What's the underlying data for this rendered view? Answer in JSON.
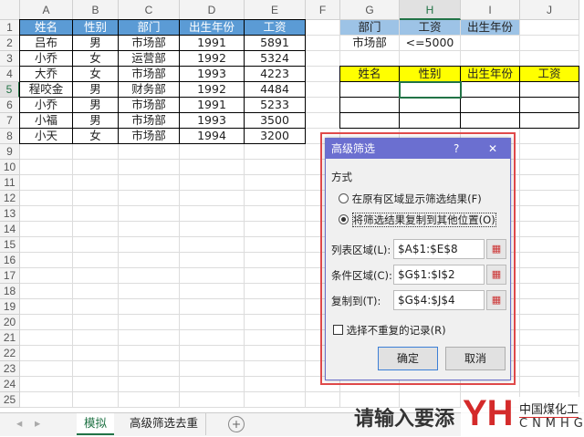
{
  "columns": [
    "A",
    "B",
    "C",
    "D",
    "E",
    "F",
    "G",
    "H",
    "I",
    "J"
  ],
  "rows": 25,
  "table": {
    "headers": [
      "姓名",
      "性别",
      "部门",
      "出生年份",
      "工资"
    ],
    "data": [
      [
        "吕布",
        "男",
        "市场部",
        "1991",
        "5891"
      ],
      [
        "小乔",
        "女",
        "运营部",
        "1992",
        "5324"
      ],
      [
        "大乔",
        "女",
        "市场部",
        "1993",
        "4223"
      ],
      [
        "程咬金",
        "男",
        "财务部",
        "1992",
        "4484"
      ],
      [
        "小乔",
        "男",
        "市场部",
        "1991",
        "5233"
      ],
      [
        "小福",
        "男",
        "市场部",
        "1993",
        "3500"
      ],
      [
        "小天",
        "女",
        "市场部",
        "1994",
        "3200"
      ]
    ]
  },
  "criteria": {
    "headers": [
      "部门",
      "工资",
      "出生年份"
    ],
    "values": [
      "市场部",
      "<=5000",
      ""
    ]
  },
  "output": {
    "headers": [
      "姓名",
      "性别",
      "出生年份",
      "工资"
    ]
  },
  "dialog": {
    "title": "高级筛选",
    "help": "?",
    "close": "✕",
    "group_label": "方式",
    "option1": "在原有区域显示筛选结果(F)",
    "option2": "将筛选结果复制到其他位置(O)",
    "list_label": "列表区域(L):",
    "list_value": "$A$1:$E$8",
    "criteria_label": "条件区域(C):",
    "criteria_value": "$G$1:$I$2",
    "copy_label": "复制到(T):",
    "copy_value": "$G$4:$J$4",
    "unique_label": "选择不重复的记录(R)",
    "ok": "确定",
    "cancel": "取消"
  },
  "tabs": {
    "items": [
      "模拟",
      "高级筛选去重"
    ],
    "active": 0,
    "add": "+"
  },
  "overlay": {
    "text": "请输入要添",
    "logo_mark": "YH",
    "logo_cn": "中国煤化工",
    "logo_en": "CNMHG"
  }
}
